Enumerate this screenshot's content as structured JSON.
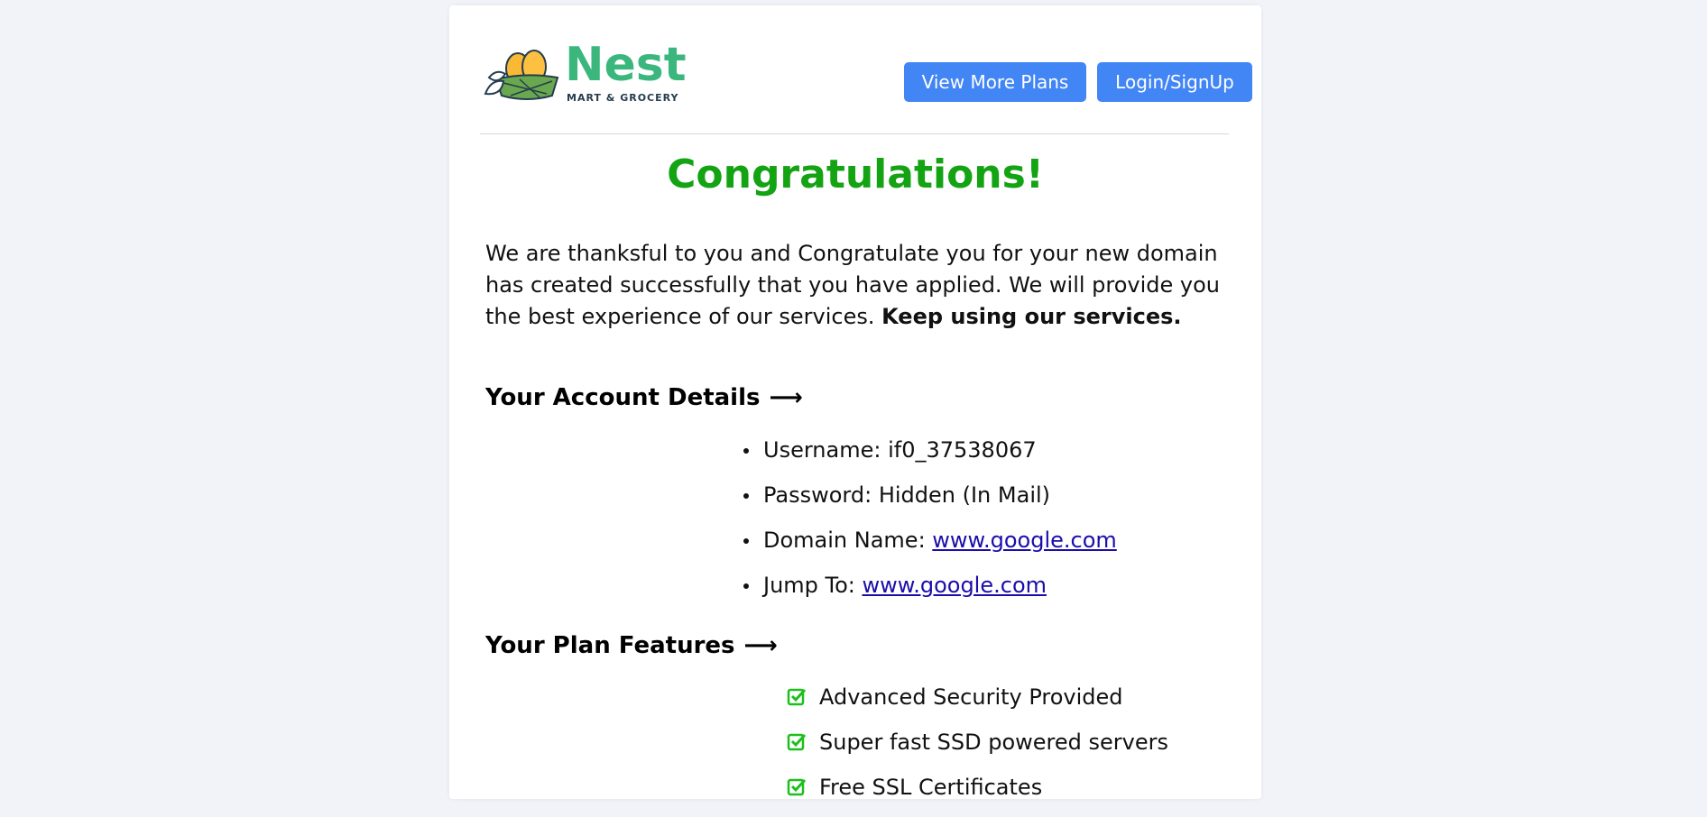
{
  "logo": {
    "name": "Nest",
    "tagline": "MART & GROCERY"
  },
  "header": {
    "plans_button": "View More Plans",
    "login_button": "Login/SignUp"
  },
  "main": {
    "title": "Congratulations!",
    "intro": "We are thanksful to you and Congratulate you for your new domain has created successfully that you have applied. We will provide you the best experience of our services.",
    "intro_bold": "Keep using our services."
  },
  "account": {
    "heading": "Your Account Details",
    "arrow": "⟶",
    "items": [
      {
        "label": "Username:",
        "value": "if0_37538067"
      },
      {
        "label": "Password:",
        "value": "Hidden (In Mail)"
      },
      {
        "label": "Domain Name:",
        "value": "www.google.com"
      },
      {
        "label": "Jump To:",
        "value": "www.google.com"
      }
    ]
  },
  "plan": {
    "heading": "Your Plan Features",
    "arrow": "⟶",
    "features": [
      "Advanced Security Provided",
      "Super fast SSD powered servers",
      "Free SSL Certificates"
    ]
  },
  "colors": {
    "accent_green": "#13a313",
    "brand_green": "#3bb77e",
    "button_blue": "#4285f4",
    "check_green": "#1cbf1c"
  },
  "icons": [
    "nest-logo-icon",
    "arrow-right-icon",
    "check-square-icon"
  ]
}
